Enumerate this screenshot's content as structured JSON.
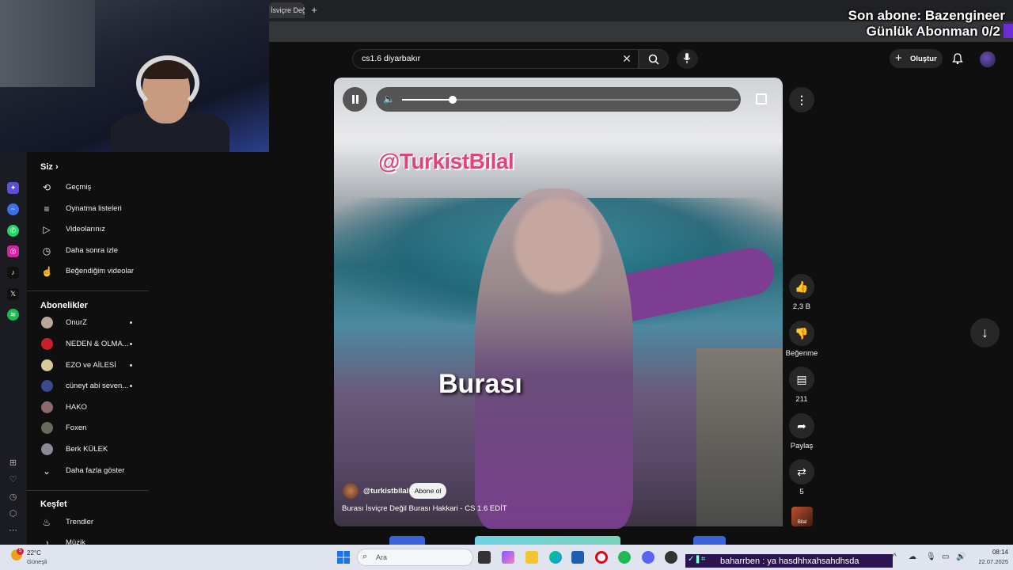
{
  "browser": {
    "tab_title": "İsviçre Değil Bu",
    "new_tab_label": "+"
  },
  "overlay": {
    "last_sub": "Son abone: Bazengineer",
    "daily_subs": "Günlük Abonman 0/2"
  },
  "search": {
    "query": "cs1.6 diyarbakır",
    "clear_icon": "close-icon",
    "search_icon": "search-icon",
    "mic_icon": "microphone-icon"
  },
  "header": {
    "create_label": "Oluştur"
  },
  "sidebar": {
    "you_heading": "Siz",
    "you_items": [
      {
        "icon": "history-icon",
        "glyph": "⟲",
        "label": "Geçmiş"
      },
      {
        "icon": "playlist-icon",
        "glyph": "≡",
        "label": "Oynatma listeleri"
      },
      {
        "icon": "video-icon",
        "glyph": "▶",
        "label": "Videolarınız"
      },
      {
        "icon": "clock-icon",
        "glyph": "◷",
        "label": "Daha sonra izle"
      },
      {
        "icon": "thumb-up-icon",
        "glyph": "👍",
        "label": "Beğendiğim videolar"
      }
    ],
    "subs_heading": "Abonelikler",
    "subscriptions": [
      {
        "label": "OnurZ",
        "color": "#b8a89a",
        "live": true
      },
      {
        "label": "NEDEN & OLMA...",
        "color": "#c8202a",
        "live": true
      },
      {
        "label": "EZO ve AİLESİ",
        "color": "#d8c8a0",
        "live": true
      },
      {
        "label": "cüneyt abi seven...",
        "color": "#3a4a8a",
        "live": true
      },
      {
        "label": "HAKO",
        "color": "#8a6a6a",
        "live": false
      },
      {
        "label": "Foxen",
        "color": "#6a6a5a",
        "live": false
      },
      {
        "label": "Berk KÜLEK",
        "color": "#8a8a9a",
        "live": false
      }
    ],
    "show_more": "Daha fazla göster",
    "explore_heading": "Keşfet",
    "explore_items": [
      {
        "icon": "trending-icon",
        "glyph": "🔥",
        "label": "Trendler"
      },
      {
        "icon": "music-icon",
        "glyph": "♪",
        "label": "Müzik"
      }
    ]
  },
  "video": {
    "watermark": "@TurkistBilal",
    "caption": "Burası",
    "channel": "@turkistbilal",
    "subscribe_label": "Abone ol",
    "title": "Burası İsviçre Değil Burası Hakkari - CS 1.6 EDİT",
    "volume_level": 0.15
  },
  "actions": {
    "likes": "2,3 B",
    "dislike_label": "Beğenme",
    "comments": "211",
    "share_label": "Paylaş",
    "remix_count": "5",
    "sound_thumb_label": "Bilal"
  },
  "taskbar": {
    "weather_temp": "22°C",
    "weather_desc": "Güneşli",
    "weather_badge": "5",
    "search_placeholder": "Ara",
    "chat_line": "baharrben : ya hasdhhxahsahdhsda",
    "time": "08:14",
    "date": "22.07.2025"
  },
  "colors": {
    "yt_bg": "#0f0f0f",
    "accent_purple": "#6b2bd6",
    "watermark_pink": "#e0447a"
  }
}
